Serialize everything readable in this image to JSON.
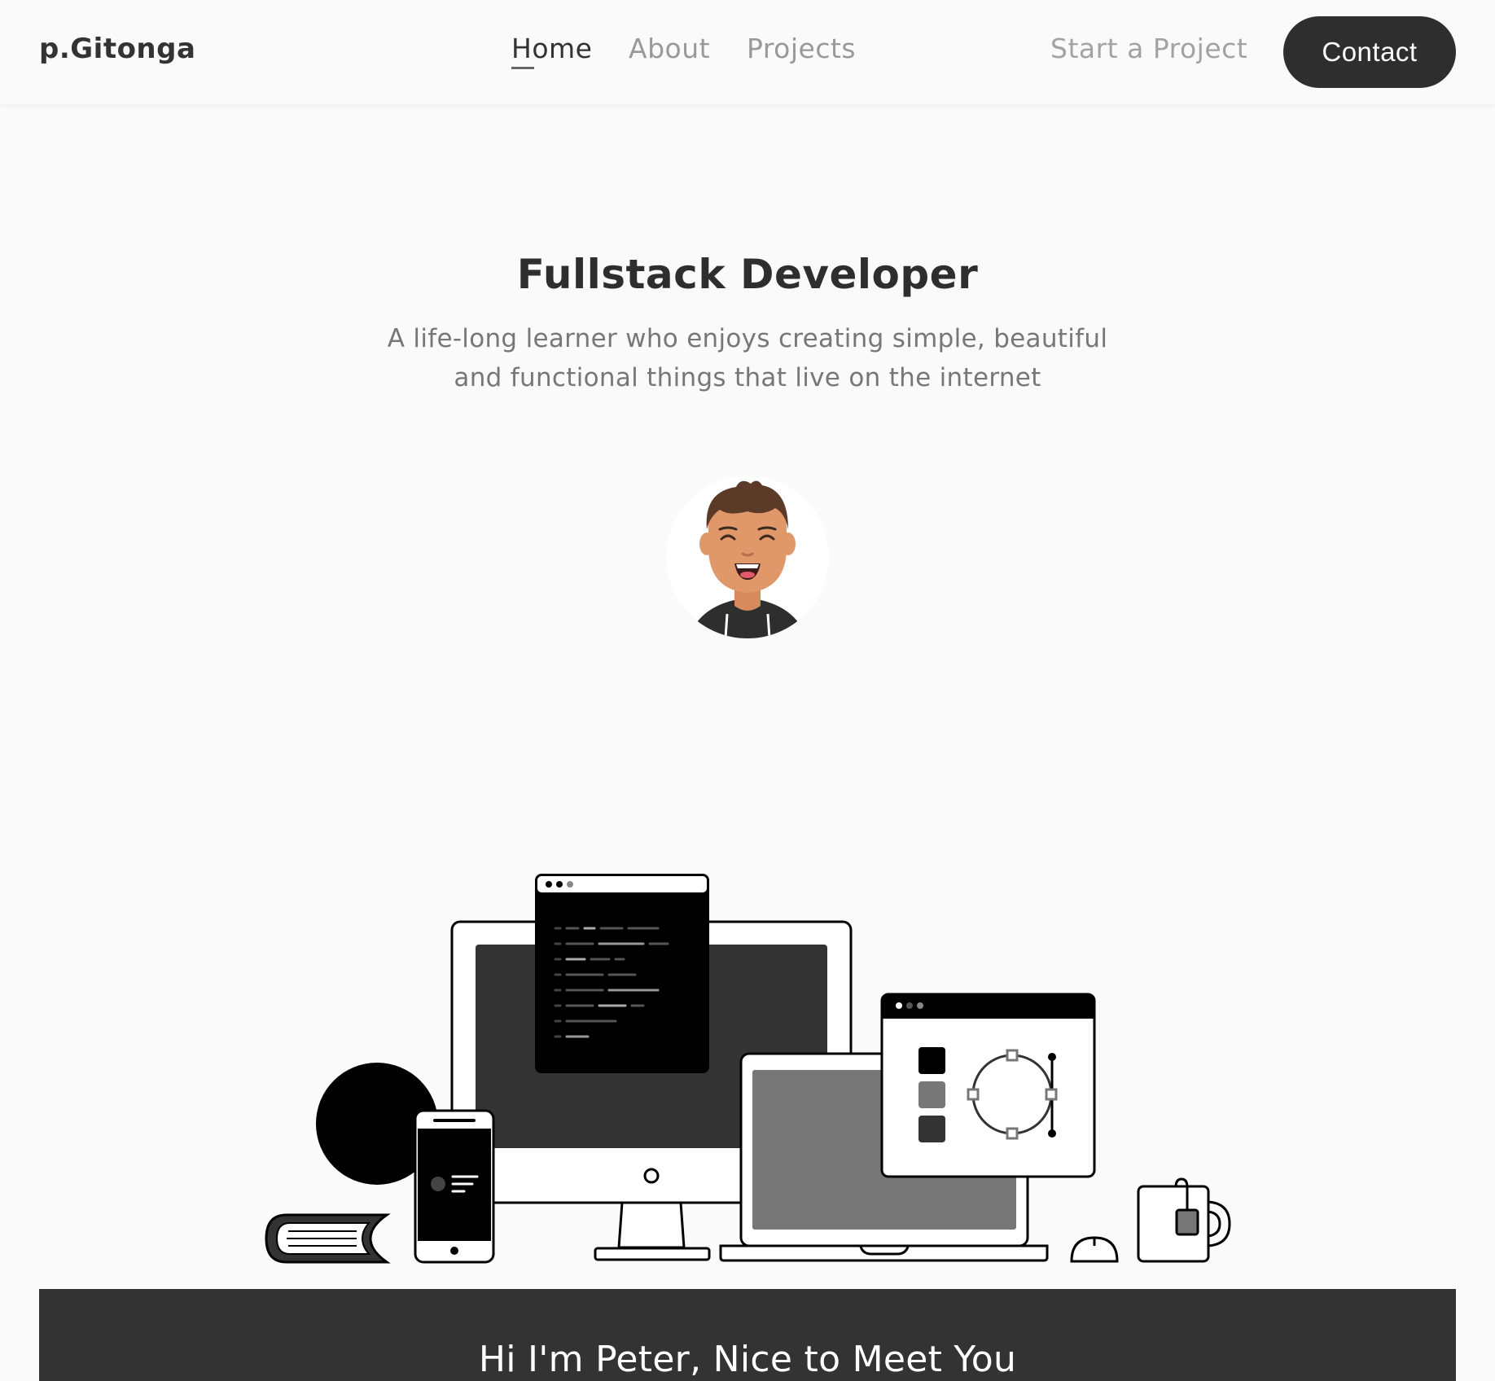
{
  "header": {
    "logo": "p.Gitonga",
    "nav": [
      {
        "label": "Home",
        "active": true
      },
      {
        "label": "About",
        "active": false
      },
      {
        "label": "Projects",
        "active": false
      }
    ],
    "start_project": "Start a Project",
    "contact": "Contact"
  },
  "hero": {
    "title": "Fullstack Developer",
    "subtitle_line1": "A life-long learner who enjoys creating simple, beautiful",
    "subtitle_line2": "and functional things that live on the internet",
    "avatar_icon": "avatar-icon",
    "illustration_icon": "workspace-illustration"
  },
  "about": {
    "heading": "Hi I'm Peter, Nice to Meet You"
  },
  "colors": {
    "dark": "#333333",
    "background": "#fafafa",
    "muted": "#999999",
    "skin": "#e0986b",
    "hair": "#5c3a28"
  }
}
